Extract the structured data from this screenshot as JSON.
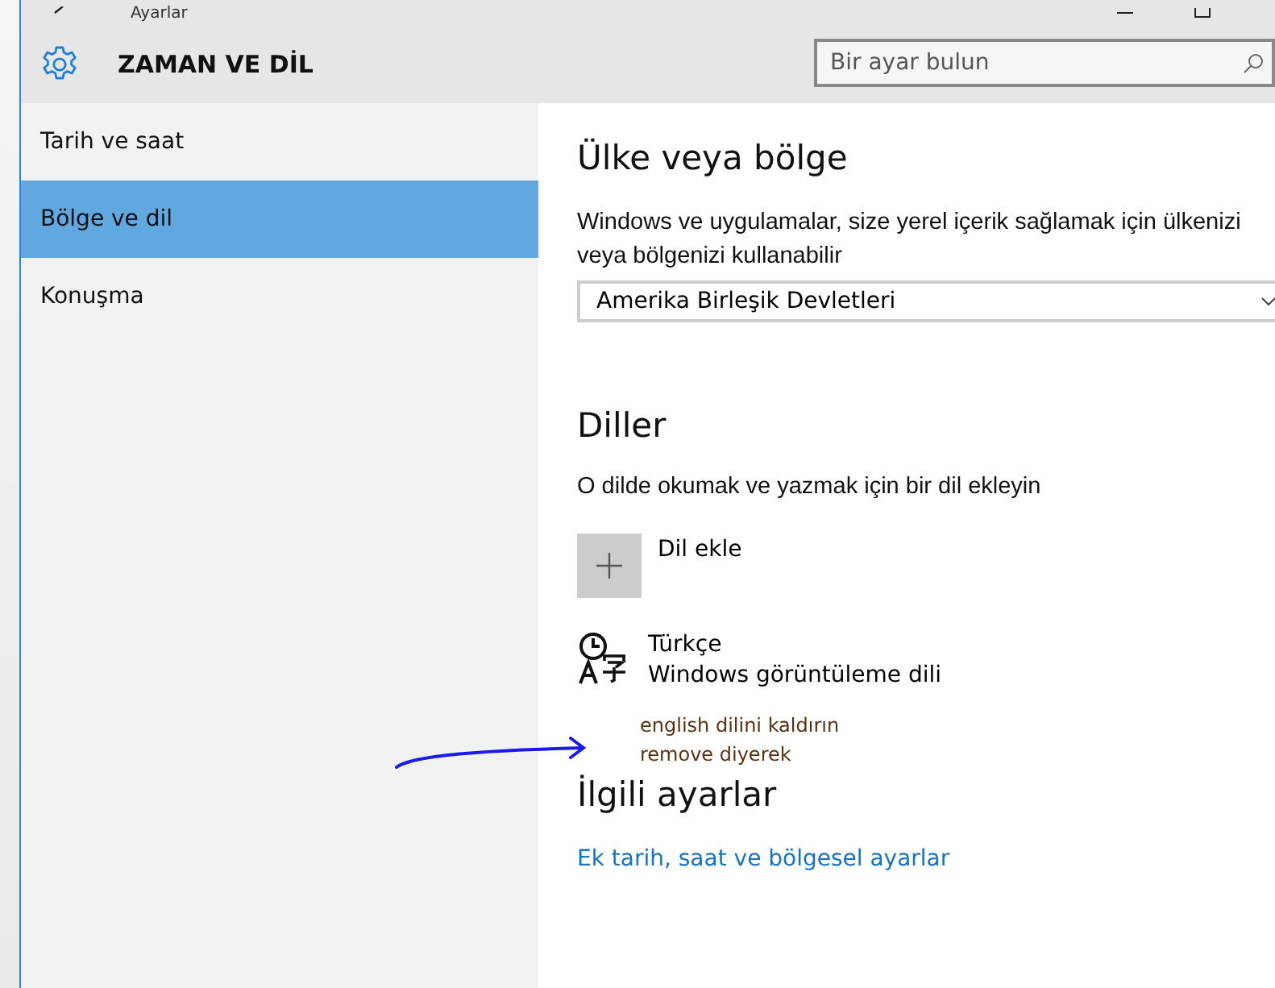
{
  "window": {
    "title": "Ayarlar"
  },
  "header": {
    "title": "ZAMAN VE DİL",
    "search": {
      "placeholder": "Bir ayar bulun"
    }
  },
  "sidebar": {
    "items": [
      {
        "label": "Tarih ve saat",
        "selected": false
      },
      {
        "label": "Bölge ve dil",
        "selected": true
      },
      {
        "label": "Konuşma",
        "selected": false
      }
    ]
  },
  "region": {
    "heading": "Ülke veya bölge",
    "description": "Windows ve uygulamalar, size yerel içerik sağlamak için ülkenizi veya bölgenizi kullanabilir",
    "country": "Amerika Birleşik Devletleri"
  },
  "languages": {
    "heading": "Diller",
    "description": "O dilde okumak ve yazmak için bir dil ekleyin",
    "add_label": "Dil ekle",
    "items": [
      {
        "name": "Türkçe",
        "note": "Windows görüntüleme dili"
      }
    ]
  },
  "annotation": {
    "lines": [
      "english dilini kaldırın",
      "remove diyerek"
    ]
  },
  "related": {
    "heading": "İlgili ayarlar",
    "link": "Ek tarih, saat ve bölgesel ayarlar"
  }
}
